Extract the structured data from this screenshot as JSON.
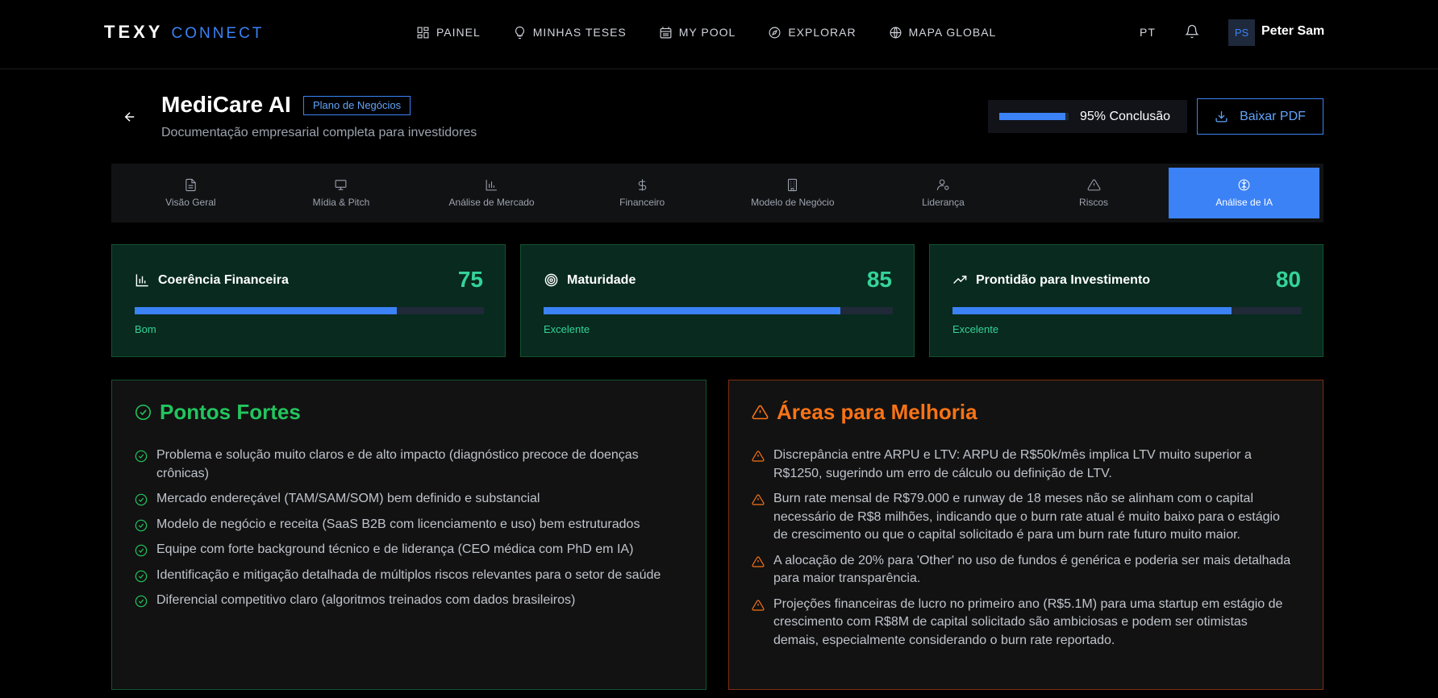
{
  "brand": {
    "part1": "TEXY",
    "part2": "CONNECT"
  },
  "nav": [
    {
      "label": "PAINEL",
      "icon": "dashboard-icon"
    },
    {
      "label": "MINHAS TESES",
      "icon": "lightbulb-icon"
    },
    {
      "label": "MY POOL",
      "icon": "pool-icon"
    },
    {
      "label": "EXPLORAR",
      "icon": "compass-icon"
    },
    {
      "label": "MAPA GLOBAL",
      "icon": "globe-icon"
    }
  ],
  "user": {
    "lang": "PT",
    "initials": "PS",
    "name": "Peter Sam"
  },
  "header": {
    "title": "MediCare AI",
    "tag": "Plano de Negócios",
    "subtitle": "Documentação empresarial completa para investidores",
    "progress_percent": 95,
    "progress_label": "95% Conclusão",
    "pdf_button": "Baixar PDF"
  },
  "tabs": [
    {
      "label": "Visão Geral",
      "icon": "document-icon",
      "active": false
    },
    {
      "label": "Mídia & Pitch",
      "icon": "presentation-icon",
      "active": false
    },
    {
      "label": "Análise de Mercado",
      "icon": "bar-chart-icon",
      "active": false
    },
    {
      "label": "Financeiro",
      "icon": "dollar-icon",
      "active": false
    },
    {
      "label": "Modelo de Negócio",
      "icon": "building-icon",
      "active": false
    },
    {
      "label": "Liderança",
      "icon": "user-gear-icon",
      "active": false
    },
    {
      "label": "Riscos",
      "icon": "warning-icon",
      "active": false
    },
    {
      "label": "Análise de IA",
      "icon": "brain-icon",
      "active": true
    }
  ],
  "scores": [
    {
      "title": "Coerência Financeira",
      "value": "75",
      "percent": 75,
      "rating": "Bom",
      "icon": "bar-chart-icon"
    },
    {
      "title": "Maturidade",
      "value": "85",
      "percent": 85,
      "rating": "Excelente",
      "icon": "target-icon"
    },
    {
      "title": "Prontidão para Investimento",
      "value": "80",
      "percent": 80,
      "rating": "Excelente",
      "icon": "trending-up-icon"
    }
  ],
  "strengths": {
    "title": "Pontos Fortes",
    "items": [
      "Problema e solução muito claros e de alto impacto (diagnóstico precoce de doenças crônicas)",
      "Mercado endereçável (TAM/SAM/SOM) bem definido e substancial",
      "Modelo de negócio e receita (SaaS B2B com licenciamento e uso) bem estruturados",
      "Equipe com forte background técnico e de liderança (CEO médica com PhD em IA)",
      "Identificação e mitigação detalhada de múltiplos riscos relevantes para o setor de saúde",
      "Diferencial competitivo claro (algoritmos treinados com dados brasileiros)"
    ]
  },
  "improvements": {
    "title": "Áreas para Melhoria",
    "items": [
      "Discrepância entre ARPU e LTV: ARPU de R$50k/mês implica LTV muito superior a R$1250, sugerindo um erro de cálculo ou definição de LTV.",
      "Burn rate mensal de R$79.000 e runway de 18 meses não se alinham com o capital necessário de R$8 milhões, indicando que o burn rate atual é muito baixo para o estágio de crescimento ou que o capital solicitado é para um burn rate futuro muito maior.",
      "A alocação de 20% para 'Other' no uso de fundos é genérica e poderia ser mais detalhada para maior transparência.",
      "Projeções financeiras de lucro no primeiro ano (R$5.1M) para uma startup em estágio de crescimento com R$8M de capital solicitado são ambiciosas e podem ser otimistas demais, especialmente considerando o burn rate reportado."
    ]
  },
  "colors": {
    "accent": "#3b82f6",
    "success": "#22c55e",
    "warning": "#f97316"
  }
}
